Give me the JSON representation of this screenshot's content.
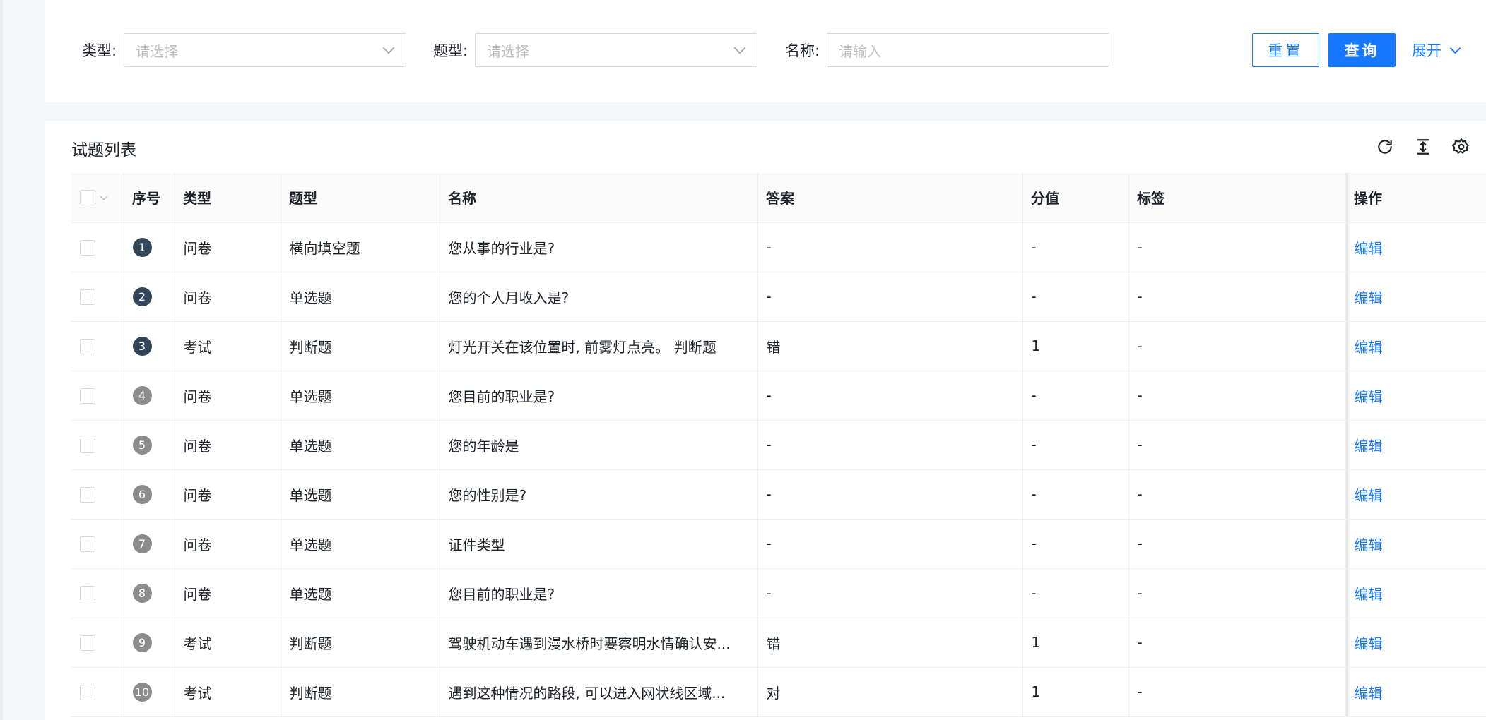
{
  "search": {
    "type_label": "类型:",
    "type_placeholder": "请选择",
    "qtype_label": "题型:",
    "qtype_placeholder": "请选择",
    "name_label": "名称:",
    "name_placeholder": "请输入",
    "reset_label": "重置",
    "query_label": "查询",
    "expand_label": "展开"
  },
  "card": {
    "title": "试题列表",
    "icons": [
      "refresh-icon",
      "density-icon",
      "settings-icon"
    ]
  },
  "table": {
    "columns": [
      "序号",
      "类型",
      "题型",
      "名称",
      "答案",
      "分值",
      "标签",
      "操作"
    ],
    "rows": [
      {
        "index": "1",
        "type": "问卷",
        "qtype": "横向填空题",
        "name": "您从事的行业是?",
        "answer": "-",
        "score": "-",
        "tag": "-",
        "action": "编辑",
        "badge": "dark"
      },
      {
        "index": "2",
        "type": "问卷",
        "qtype": "单选题",
        "name": "您的个人月收入是?",
        "answer": "-",
        "score": "-",
        "tag": "-",
        "action": "编辑",
        "badge": "dark"
      },
      {
        "index": "3",
        "type": "考试",
        "qtype": "判断题",
        "name": "灯光开关在该位置时, 前雾灯点亮。 判断题",
        "answer": "错",
        "score": "1",
        "tag": "-",
        "action": "编辑",
        "badge": "dark"
      },
      {
        "index": "4",
        "type": "问卷",
        "qtype": "单选题",
        "name": "您目前的职业是?",
        "answer": "-",
        "score": "-",
        "tag": "-",
        "action": "编辑",
        "badge": "grey"
      },
      {
        "index": "5",
        "type": "问卷",
        "qtype": "单选题",
        "name": "您的年龄是",
        "answer": "-",
        "score": "-",
        "tag": "-",
        "action": "编辑",
        "badge": "grey"
      },
      {
        "index": "6",
        "type": "问卷",
        "qtype": "单选题",
        "name": "您的性别是?",
        "answer": "-",
        "score": "-",
        "tag": "-",
        "action": "编辑",
        "badge": "grey"
      },
      {
        "index": "7",
        "type": "问卷",
        "qtype": "单选题",
        "name": "证件类型",
        "answer": "-",
        "score": "-",
        "tag": "-",
        "action": "编辑",
        "badge": "grey"
      },
      {
        "index": "8",
        "type": "问卷",
        "qtype": "单选题",
        "name": "您目前的职业是?",
        "answer": "-",
        "score": "-",
        "tag": "-",
        "action": "编辑",
        "badge": "grey"
      },
      {
        "index": "9",
        "type": "考试",
        "qtype": "判断题",
        "name": "驾驶机动车遇到漫水桥时要察明水情确认安...",
        "answer": "错",
        "score": "1",
        "tag": "-",
        "action": "编辑",
        "badge": "grey"
      },
      {
        "index": "10",
        "type": "考试",
        "qtype": "判断题",
        "name": "遇到这种情况的路段, 可以进入网状线区域...",
        "answer": "对",
        "score": "1",
        "tag": "-",
        "action": "编辑",
        "badge": "grey"
      }
    ]
  },
  "colors": {
    "primary": "#1677ff",
    "badge_dark": "#314659",
    "badge_grey": "#8c8c8c"
  }
}
